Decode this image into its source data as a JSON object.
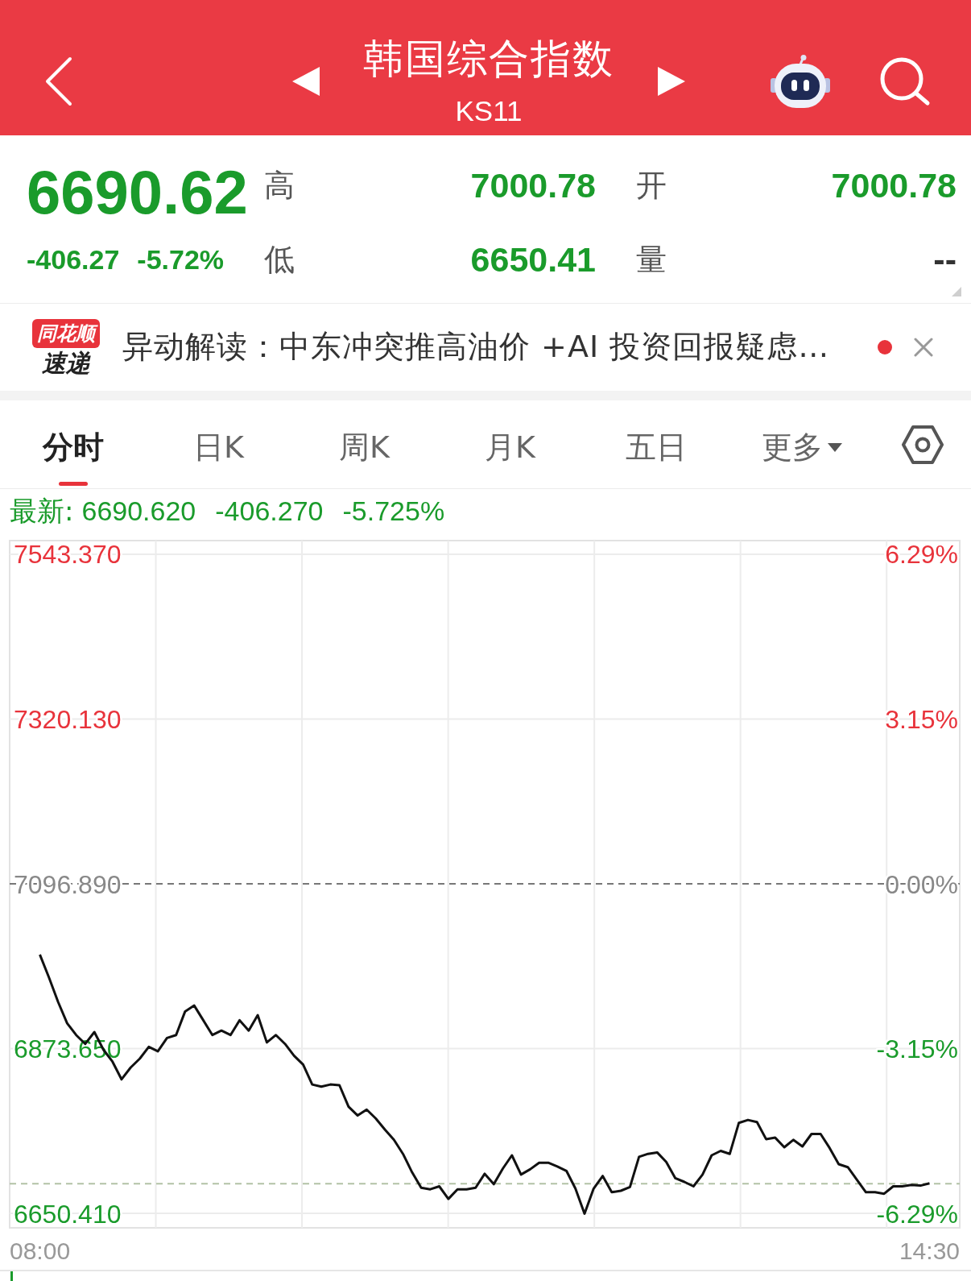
{
  "header": {
    "title": "韩国综合指数",
    "code": "KS11"
  },
  "quote": {
    "price": "6690.62",
    "change": "-406.27",
    "change_pct": "-5.72%",
    "stats": [
      {
        "label": "高",
        "value": "7000.78",
        "color": "#1a9b2b"
      },
      {
        "label": "开",
        "value": "7000.78",
        "color": "#1a9b2b"
      },
      {
        "label": "低",
        "value": "6650.41",
        "color": "#1a9b2b"
      },
      {
        "label": "量",
        "value": "--",
        "color": "#333333"
      }
    ]
  },
  "news": {
    "logo_top": "同花顺",
    "logo_bottom": "速递",
    "text": "异动解读：中东冲突推高油价 +AI 投资回报疑虑…",
    "unread": true
  },
  "tabs": [
    {
      "label": "分时",
      "kind": "tab",
      "selected": true
    },
    {
      "label": "日K",
      "kind": "tab",
      "selected": false
    },
    {
      "label": "周K",
      "kind": "tab",
      "selected": false
    },
    {
      "label": "月K",
      "kind": "tab",
      "selected": false
    },
    {
      "label": "五日",
      "kind": "tab",
      "selected": false
    },
    {
      "label": "更多",
      "kind": "dropdown",
      "selected": false
    }
  ],
  "latest": {
    "label": "最新:",
    "price": "6690.620",
    "change": "-406.270",
    "change_pct": "-5.725%"
  },
  "chart": {
    "percent_labels": [
      "6.29%",
      "3.15%",
      "0.00%",
      "-3.15%",
      "-6.29%"
    ],
    "chart_data": {
      "type": "line",
      "categories": [
        "08:00",
        null,
        null,
        null,
        null,
        null,
        null,
        null,
        null,
        null,
        null,
        null,
        null,
        null,
        null,
        null,
        null,
        null,
        null,
        null,
        null,
        null,
        null,
        null,
        null,
        null,
        null,
        null,
        null,
        null,
        null,
        null,
        null,
        null,
        null,
        null,
        null,
        null,
        null,
        null,
        null,
        null,
        null,
        null,
        null,
        null,
        null,
        null,
        null,
        null,
        null,
        null,
        null,
        null,
        null,
        null,
        null,
        null,
        null,
        null,
        null,
        null,
        null,
        null,
        null,
        null,
        null,
        null,
        null,
        null,
        null,
        null,
        null,
        null,
        null,
        null,
        null,
        null,
        null,
        null,
        null,
        null,
        null,
        null,
        null,
        null,
        null,
        null,
        null,
        null,
        null,
        null,
        null,
        null,
        null,
        null,
        null,
        null,
        "14:30"
      ],
      "series": [
        {
          "color": "#111111",
          "values": [
            7001,
            6970,
            6937,
            6908,
            6892,
            6880,
            6896,
            6872,
            6856,
            6832,
            6848,
            6860,
            6876,
            6870,
            6888,
            6892,
            6924,
            6932,
            6912,
            6892,
            6898,
            6892,
            6912,
            6898,
            6919,
            6882,
            6892,
            6880,
            6864,
            6852,
            6825,
            6822,
            6825,
            6824,
            6795,
            6783,
            6791,
            6779,
            6764,
            6750,
            6731,
            6706,
            6685,
            6683,
            6687,
            6670,
            6683,
            6683,
            6685,
            6704,
            6690,
            6711,
            6729,
            6703,
            6710,
            6719,
            6719,
            6714,
            6708,
            6684,
            6650,
            6684,
            6701,
            6679,
            6681,
            6686,
            6727,
            6731,
            6733,
            6720,
            6698,
            6693,
            6687,
            6703,
            6729,
            6735,
            6731,
            6773,
            6777,
            6774,
            6751,
            6753,
            6740,
            6750,
            6741,
            6758,
            6758,
            6739,
            6717,
            6713,
            6696,
            6679,
            6679,
            6677,
            6687,
            6687,
            6689,
            6688,
            6691
          ]
        }
      ],
      "ylim": [
        6630.8,
        7561.9
      ],
      "yticks": [
        {
          "value": 7543.37,
          "label": "7543.370"
        },
        {
          "value": 7320.13,
          "label": "7320.130"
        },
        {
          "value": 7096.89,
          "label": "7096.890"
        },
        {
          "value": 6873.65,
          "label": "6873.650"
        },
        {
          "value": 6650.41,
          "label": "6650.410"
        }
      ],
      "grid": true,
      "ref_lines": [
        {
          "axis": "y",
          "value": 7096.89,
          "color": "#777777"
        },
        {
          "axis": "y",
          "value": 6690.62,
          "color": "#b3c2a6"
        }
      ]
    }
  }
}
